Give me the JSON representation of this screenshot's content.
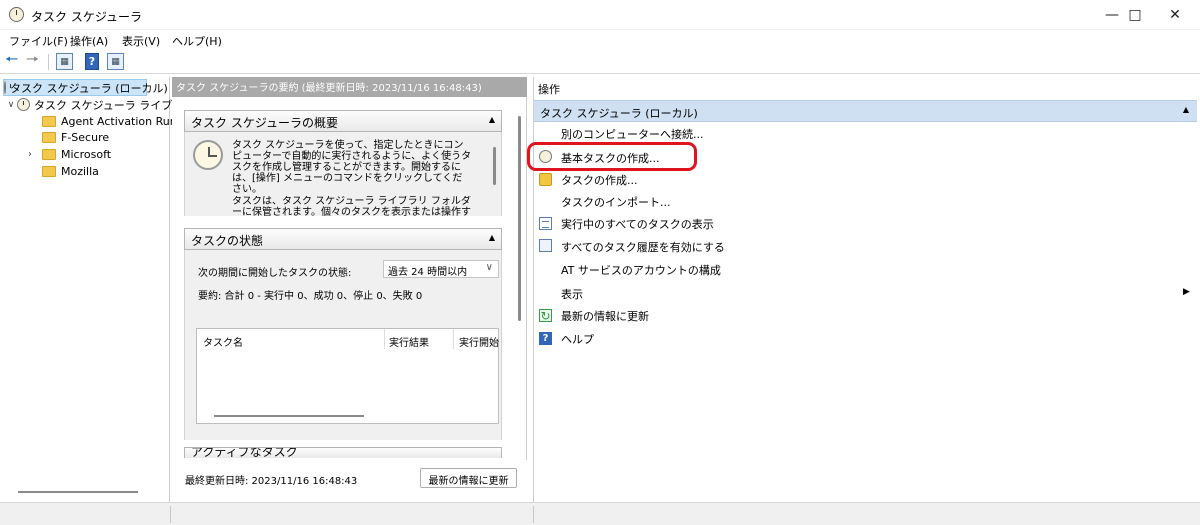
{
  "window": {
    "title": "タスク スケジューラ"
  },
  "menu": [
    "ファイル(F)",
    "操作(A)",
    "表示(V)",
    "ヘルプ(H)"
  ],
  "tree": {
    "root": "タスク スケジューラ (ローカル)",
    "library": "タスク スケジューラ ライブラリ",
    "children": [
      "Agent Activation Runt",
      "F-Secure",
      "Microsoft",
      "Mozilla"
    ]
  },
  "middle": {
    "header": "タスク スケジューラの要約 (最終更新日時: 2023/11/16 16:48:43)",
    "overview": {
      "title": "タスク スケジューラの概要",
      "para1": "タスク スケジューラを使って、指定したときにコンピューターで自動的に実行されるように、よく使うタスクを作成し管理することができます。開始するには、[操作] メニューのコマンドをクリックしてください。",
      "para2": "タスクは、タスク スケジューラ ライブラリ フォルダーに保管されます。個々のタスクを表示または操作するには、タス"
    },
    "status": {
      "title": "タスクの状態",
      "period_label": "次の期間に開始したタスクの状態:",
      "period_value": "過去 24 時間以内",
      "summary": "要約: 合計 0 - 実行中 0、成功 0、停止 0、失敗 0",
      "columns": [
        "タスク名",
        "実行結果",
        "実行開始"
      ]
    },
    "active": {
      "title": "アクティブなタスク"
    },
    "footer": {
      "last_updated": "最終更新日時: 2023/11/16 16:48:43",
      "refresh_button": "最新の情報に更新"
    }
  },
  "actions": {
    "title": "操作",
    "group": "タスク スケジューラ (ローカル)",
    "items": [
      {
        "label": "別のコンピューターへ接続...",
        "icon": "none"
      },
      {
        "label": "基本タスクの作成...",
        "icon": "basic-task-icon"
      },
      {
        "label": "タスクの作成...",
        "icon": "create-task-icon"
      },
      {
        "label": "タスクのインポート...",
        "icon": "none"
      },
      {
        "label": "実行中のすべてのタスクの表示",
        "icon": "running-tasks-icon"
      },
      {
        "label": "すべてのタスク履歴を有効にする",
        "icon": "history-icon"
      },
      {
        "label": "AT サービスのアカウントの構成",
        "icon": "none"
      },
      {
        "label": "表示",
        "icon": "none"
      },
      {
        "label": "最新の情報に更新",
        "icon": "refresh-icon"
      },
      {
        "label": "ヘルプ",
        "icon": "help-icon"
      }
    ]
  },
  "colors": {
    "highlight": "#e0141e",
    "actions_header": "#cfe0f2",
    "selected": "#cce4f7"
  }
}
